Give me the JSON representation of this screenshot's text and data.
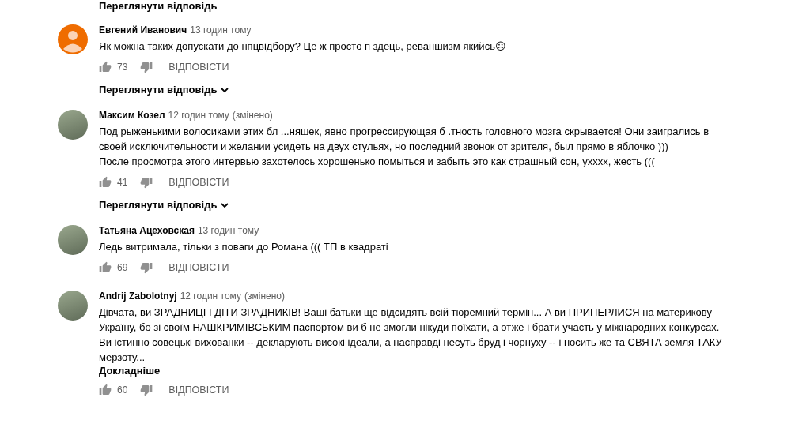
{
  "top_replies_link": {
    "label": "Переглянути відповідь"
  },
  "comments": [
    {
      "author": "Евгений Иванович",
      "time": "13 годин тому",
      "avatar": {
        "kind": "default"
      },
      "paragraphs": [
        "Як можна таких допускати до нпцвідбору? Це ж просто п  здець, реваншизм якийсь☹"
      ],
      "likes": "73",
      "reply": "ВІДПОВІСТИ",
      "replies_link": "Переглянути відповідь"
    },
    {
      "author": "Максим Козел",
      "time": "12 годин тому",
      "edited": "(змінено)",
      "avatar": {
        "kind": "photo"
      },
      "paragraphs": [
        "Под рыженькими волосиками этих бл  ...няшек, явно прогрессирующая б .тность головного мозга скрывается! Они заигрались в своей исключительности и желании усидеть на двух стульях, но последний звонок от зрителя, был прямо в яблочко )))",
        "После просмотра этого интервью захотелось хорошенько помыться и забыть это как страшный сон, ухххх, жесть ((("
      ],
      "likes": "41",
      "reply": "ВІДПОВІСТИ",
      "replies_link": "Переглянути відповідь"
    },
    {
      "author": "Татьяна Ацеховская",
      "time": "13 годин тому",
      "avatar": {
        "kind": "photo"
      },
      "paragraphs": [
        "Ледь витримала, тільки з поваги до Романа ((( ТП в квадраті"
      ],
      "likes": "69",
      "reply": "ВІДПОВІСТИ"
    },
    {
      "author": "Andrij Zabolotnyj",
      "time": "12 годин тому",
      "edited": "(змінено)",
      "avatar": {
        "kind": "photo"
      },
      "paragraphs": [
        "Дівчата, ви ЗРАДНИЦІ І ДІТИ ЗРАДНИКІВ! Ваші батьки ще відсидять всій тюремний термін... А ви ПРИПЕРЛИСЯ на материкову Україну, бо зі своїм НАШКРИМІВСЬКИМ паспортом ви б не змогли нікуди поїхати, а отже і брати участь у міжнародних конкурсах. Ви істинно совецькі вихованки -- декларують високі ідеали, а насправді несуть бруд і чорнуху -- і носить же та СВЯТА земля ТАКУ мерзоту..."
      ],
      "read_more": "Докладніше",
      "likes": "60",
      "reply": "ВІДПОВІСТИ"
    }
  ]
}
